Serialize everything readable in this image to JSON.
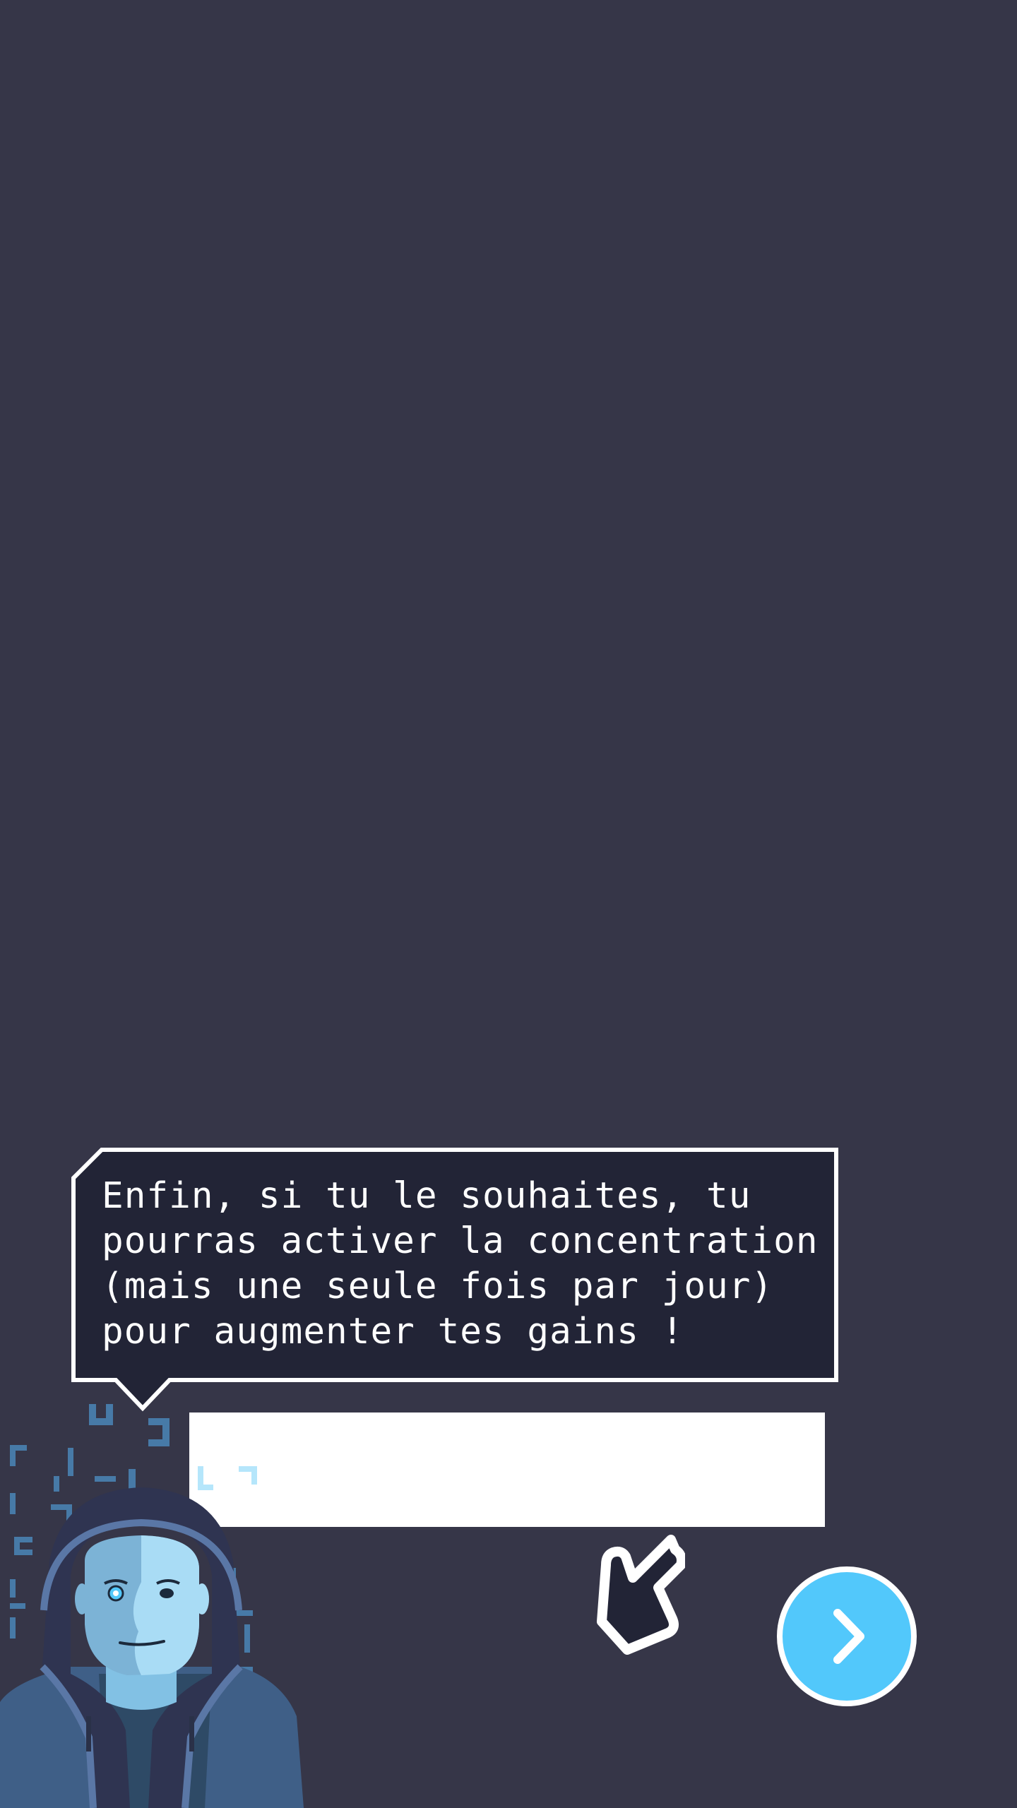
{
  "tutorial": {
    "message": "Enfin, si tu le souhaites, tu\npourras activer la concentration\n(mais une seule fois par jour)\npour augmenter tes gains !"
  },
  "next_button": {
    "icon": "chevron-right-icon"
  },
  "colors": {
    "background": "#363648",
    "bubble_fill": "#222436",
    "bubble_border": "#ffffff",
    "accent": "#52c8fb",
    "hand_fill": "#222436"
  }
}
